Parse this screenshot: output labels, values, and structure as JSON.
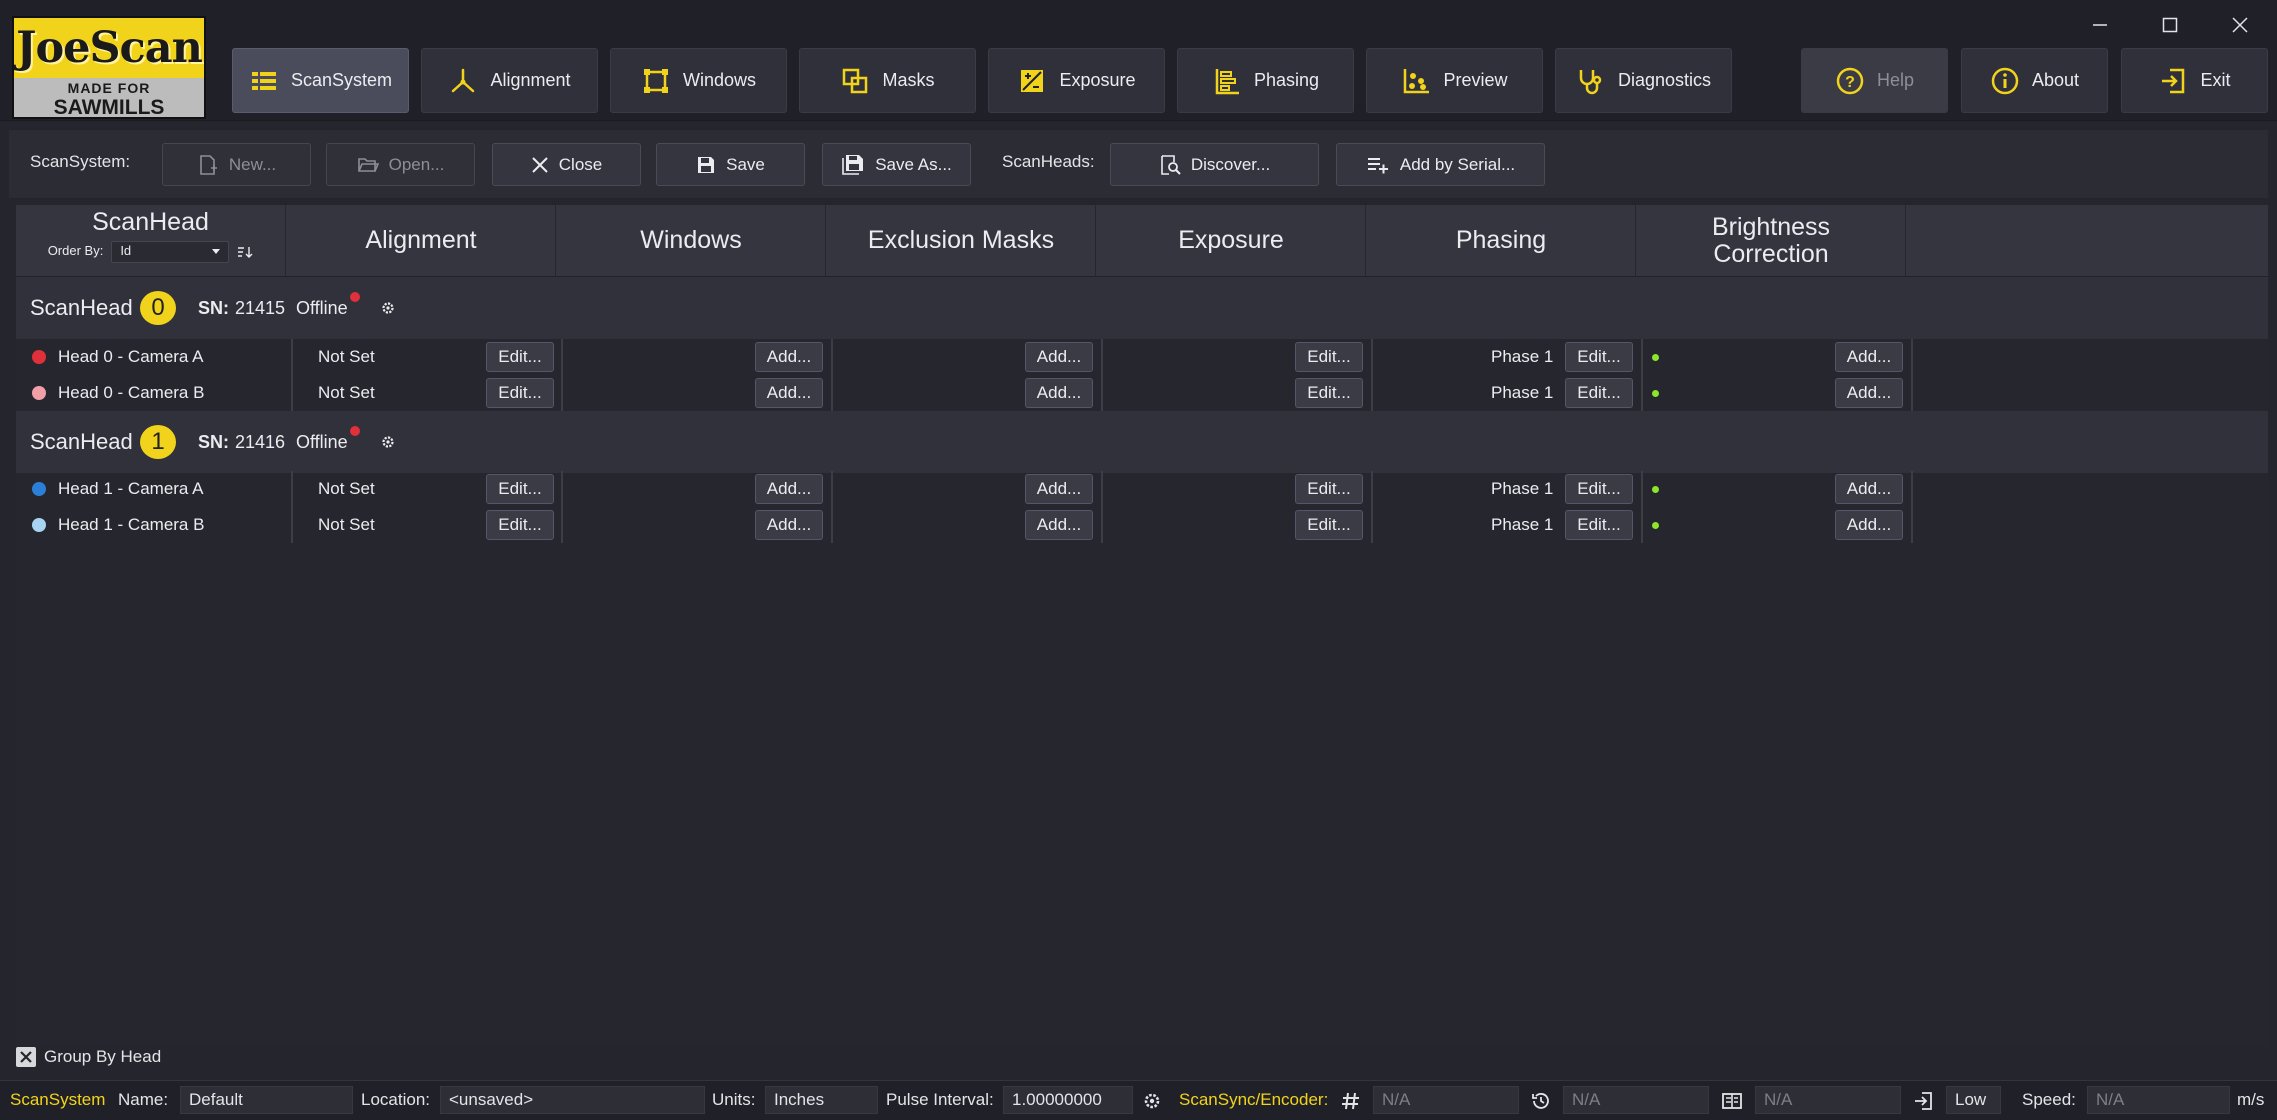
{
  "app": {
    "logo_top": "JoeScan",
    "logo_line1": "MADE FOR",
    "logo_line2": "SAWMILLS",
    "accent_color": "#f2d31c"
  },
  "nav": {
    "items": [
      {
        "label": "ScanSystem",
        "icon": "table-list-icon"
      },
      {
        "label": "Alignment",
        "icon": "axes-icon"
      },
      {
        "label": "Windows",
        "icon": "window-frame-icon"
      },
      {
        "label": "Masks",
        "icon": "overlap-squares-icon"
      },
      {
        "label": "Exposure",
        "icon": "exposure-icon"
      },
      {
        "label": "Phasing",
        "icon": "phasing-icon"
      },
      {
        "label": "Preview",
        "icon": "scatter-icon"
      },
      {
        "label": "Diagnostics",
        "icon": "stethoscope-icon"
      }
    ],
    "help": "Help",
    "about": "About",
    "exit": "Exit"
  },
  "toolbar": {
    "scansystem_label": "ScanSystem:",
    "new": "New...",
    "open": "Open...",
    "close": "Close",
    "save": "Save",
    "save_as": "Save As...",
    "scanheads_label": "ScanHeads:",
    "discover": "Discover...",
    "add_serial": "Add by Serial..."
  },
  "table": {
    "headers": {
      "scanhead": "ScanHead",
      "order_by_label": "Order By:",
      "order_by_value": "Id",
      "alignment": "Alignment",
      "windows": "Windows",
      "exclusion_masks": "Exclusion Masks",
      "exposure": "Exposure",
      "phasing": "Phasing",
      "brightness_1": "Brightness",
      "brightness_2": "Correction"
    },
    "groups": [
      {
        "title": "ScanHead",
        "id": "0",
        "sn_label": "SN:",
        "sn": "21415",
        "status": "Offline",
        "rows": [
          {
            "camera": "Head 0 - Camera A",
            "dot_color": "#e0303a",
            "alignment": "Not Set",
            "align_btn": "Edit...",
            "windows_btn": "Add...",
            "masks_btn": "Add...",
            "exposure_btn": "Edit...",
            "phase": "Phase 1",
            "phase_btn": "Edit...",
            "brightness_btn": "Add..."
          },
          {
            "camera": "Head 0 - Camera B",
            "dot_color": "#f2a0a8",
            "alignment": "Not Set",
            "align_btn": "Edit...",
            "windows_btn": "Add...",
            "masks_btn": "Add...",
            "exposure_btn": "Edit...",
            "phase": "Phase 1",
            "phase_btn": "Edit...",
            "brightness_btn": "Add..."
          }
        ]
      },
      {
        "title": "ScanHead",
        "id": "1",
        "sn_label": "SN:",
        "sn": "21416",
        "status": "Offline",
        "rows": [
          {
            "camera": "Head 1 - Camera A",
            "dot_color": "#2b7fd8",
            "alignment": "Not Set",
            "align_btn": "Edit...",
            "windows_btn": "Add...",
            "masks_btn": "Add...",
            "exposure_btn": "Edit...",
            "phase": "Phase 1",
            "phase_btn": "Edit...",
            "brightness_btn": "Add..."
          },
          {
            "camera": "Head 1 - Camera B",
            "dot_color": "#a8d4f2",
            "alignment": "Not Set",
            "align_btn": "Edit...",
            "windows_btn": "Add...",
            "masks_btn": "Add...",
            "exposure_btn": "Edit...",
            "phase": "Phase 1",
            "phase_btn": "Edit...",
            "brightness_btn": "Add..."
          }
        ]
      }
    ]
  },
  "group_by_head": "Group By Head",
  "statusbar": {
    "scansystem": "ScanSystem",
    "name_label": "Name:",
    "name_value": "Default",
    "location_label": "Location:",
    "location_value": "<unsaved>",
    "units_label": "Units:",
    "units_value": "Inches",
    "pulse_label": "Pulse Interval:",
    "pulse_value": "1.00000000",
    "scansync": "ScanSync/Encoder:",
    "encoder_value": "N/A",
    "time_value": "N/A",
    "third_value": "N/A",
    "level": "Low",
    "speed_label": "Speed:",
    "speed_value": "N/A",
    "speed_unit": "m/s"
  }
}
